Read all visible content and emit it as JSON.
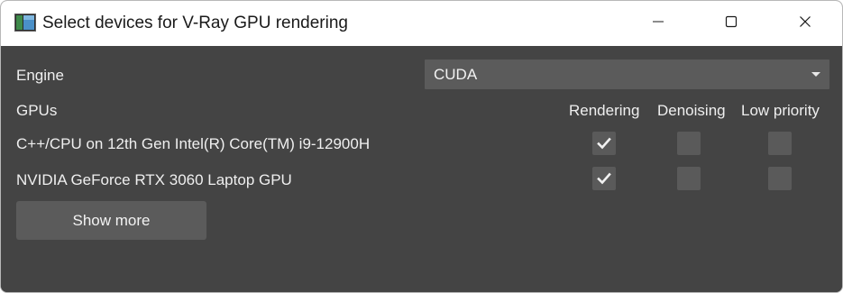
{
  "window": {
    "title": "Select devices for V-Ray GPU rendering",
    "app_icon": "vray-window-icon",
    "controls": [
      "minimize-icon",
      "maximize-icon",
      "close-icon"
    ]
  },
  "engine": {
    "label": "Engine",
    "selected": "CUDA"
  },
  "gpus": {
    "label": "GPUs",
    "columns": [
      "Rendering",
      "Denoising",
      "Low priority"
    ],
    "devices": [
      {
        "name": "C++/CPU on 12th Gen Intel(R) Core(TM) i9-12900H",
        "rendering": true,
        "denoising": false,
        "low_priority": false
      },
      {
        "name": "NVIDIA GeForce RTX 3060 Laptop GPU",
        "rendering": true,
        "denoising": false,
        "low_priority": false
      }
    ]
  },
  "show_more": {
    "label": "Show more"
  },
  "colors": {
    "background": "#444444",
    "control": "#5b5b5b",
    "text": "#efefef",
    "titlebar": "#ffffff"
  }
}
